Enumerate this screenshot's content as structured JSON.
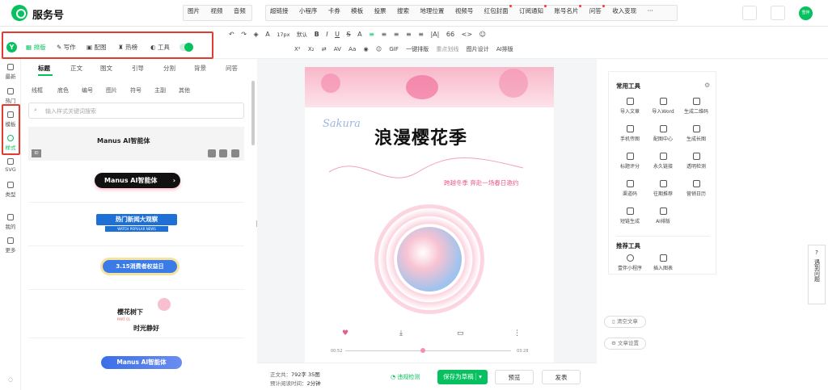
{
  "app": {
    "title": "服务号"
  },
  "top_menu": {
    "group1": [
      "图片",
      "视频",
      "音频"
    ],
    "group2": [
      "超链接",
      "小程序",
      "卡券",
      "模板",
      "投票",
      "搜索",
      "地理位置",
      "视频号",
      "红包封面",
      "订阅通知",
      "账号名片",
      "问答",
      "收入变现"
    ],
    "dots_after": [
      "红包封面",
      "订阅通知",
      "账号名片",
      "问答"
    ],
    "more": "···"
  },
  "avatar_text": "雪伴",
  "mode_tabs": [
    "排版",
    "写作",
    "配图",
    "热榜",
    "工具"
  ],
  "fmt_row1": [
    "↶",
    "↷",
    "◈",
    "A",
    "17px",
    "默认",
    "B",
    "I",
    "U",
    "S",
    "A",
    "≡",
    "≡",
    "≡",
    "≡",
    "≡",
    "|A|",
    "66",
    "<>",
    "☺"
  ],
  "fmt_row2": [
    "X²",
    "X₂",
    "⇄",
    "AV",
    "Aa",
    "◉",
    "☺",
    "GIF",
    "一键排版",
    "重点划线",
    "图片设计",
    "AI排版"
  ],
  "left_nav": [
    "最新",
    "热门",
    "模板",
    "样式",
    "SVG",
    "类型",
    "我的",
    "更多"
  ],
  "panel": {
    "tabs": [
      "标题",
      "正文",
      "图文",
      "引导",
      "分割",
      "背景",
      "问答"
    ],
    "chips": [
      "线框",
      "底色",
      "编号",
      "图片",
      "符号",
      "主副",
      "其他"
    ],
    "search_placeholder": "输入样式关键词搜索",
    "items": [
      "Manus AI智能体",
      "Manus AI智能体",
      "热门新闻大观察",
      "WATCH POPULAR NEWS",
      "3.15消费者权益日",
      "樱花树下",
      "时光静好",
      "Manus AI智能体"
    ],
    "part": "PART 01",
    "id_badge": "ID"
  },
  "article": {
    "sakura": "Sakura",
    "title": "浪漫樱花季",
    "subtitle": "跨越冬季 奔赴一场春日邀约",
    "time_start": "00:52",
    "time_end": "03:28"
  },
  "tools": {
    "header": "常用工具",
    "items": [
      "导入文章",
      "导入Word",
      "生成二维码",
      "手机传图",
      "配图中心",
      "生成长图",
      "标题评分",
      "永久链接",
      "透明检测",
      "渠道码",
      "往期推荐",
      "营销日历",
      "短链生成",
      "AI排版"
    ],
    "rec_header": "推荐工具",
    "rec_items": [
      "壹伴小程序",
      "插入图表"
    ]
  },
  "side_buttons": [
    "清空文章",
    "文章设置"
  ],
  "footer": {
    "count_label": "正文共：",
    "count_value": "792字 35图",
    "time_label": "预计阅读时间：",
    "time_value": "2分钟",
    "check": "违规检测",
    "save": "保存为草稿",
    "preview": "预览",
    "publish": "发表"
  },
  "help": "遇到问题",
  "colors": {
    "green": "#07c160",
    "red": "#e23b30",
    "pink": "#f06292"
  }
}
